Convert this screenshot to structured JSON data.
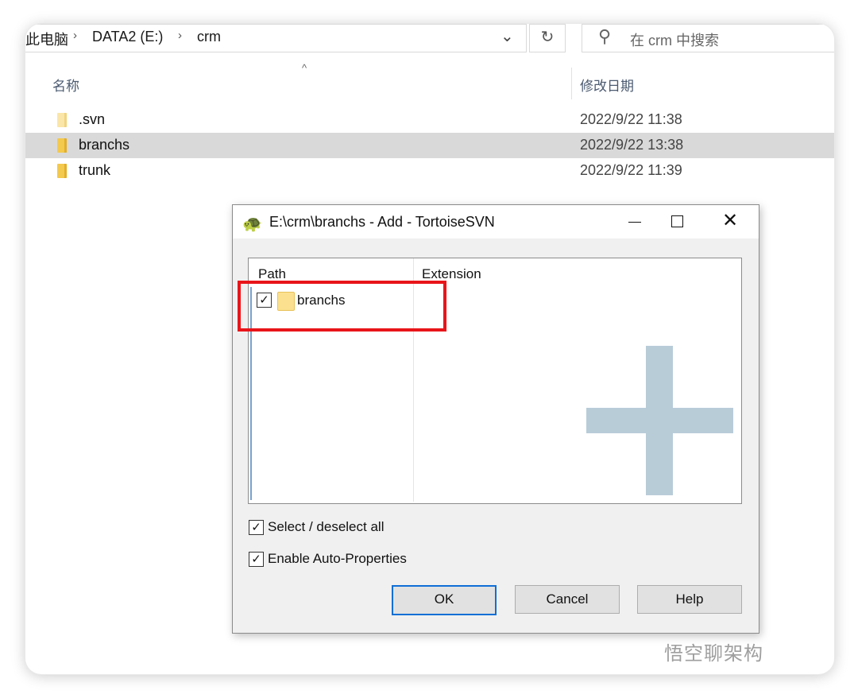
{
  "breadcrumb": {
    "item1": "此电脑",
    "item2": "DATA2 (E:)",
    "item3": "crm",
    "sep": "›",
    "dropdown": "⌄",
    "refresh": "↻"
  },
  "search": {
    "placeholder": "在 crm 中搜索",
    "icon": "search-icon"
  },
  "columns": {
    "name": "名称",
    "date": "修改日期",
    "sort_indicator": "^"
  },
  "files": [
    {
      "name": ".svn",
      "date": "2022/9/22 11:38"
    },
    {
      "name": "branchs",
      "date": "2022/9/22 13:38",
      "selected": true
    },
    {
      "name": "trunk",
      "date": "2022/9/22 11:39"
    }
  ],
  "dialog": {
    "title": "E:\\crm\\branchs - Add - TortoiseSVN",
    "close_glyph": "✕",
    "list_headers": {
      "path": "Path",
      "extension": "Extension"
    },
    "items": [
      {
        "name": "branchs",
        "checked": true
      }
    ],
    "select_all_label": "Select / deselect all",
    "auto_props_label": "Enable Auto-Properties",
    "check_glyph": "✓",
    "buttons": {
      "ok": "OK",
      "cancel": "Cancel",
      "help": "Help"
    },
    "highlight_color": "#e8151a"
  },
  "watermark": "悟空聊架构"
}
